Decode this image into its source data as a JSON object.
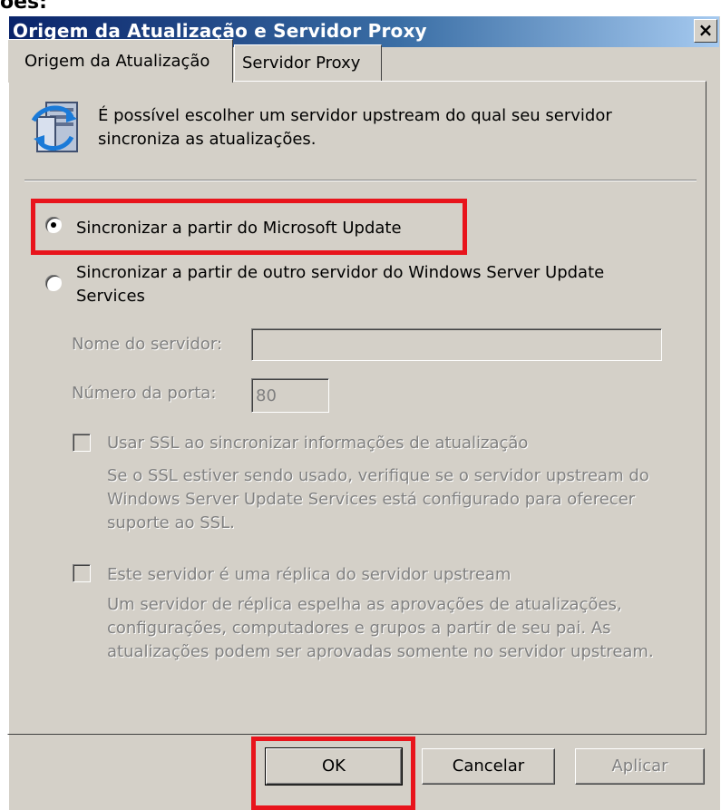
{
  "window": {
    "title": "Origem da Atualização e Servidor Proxy",
    "close_label": "×"
  },
  "tabs": [
    {
      "label": "Origem da Atualização",
      "active": true
    },
    {
      "label": "Servidor Proxy",
      "active": false
    }
  ],
  "intro_text": "É possível escolher um servidor upstream do qual seu servidor sincroniza as atualizações.",
  "options": {
    "microsoft_update": {
      "label": "Sincronizar a partir do Microsoft Update",
      "selected": true
    },
    "other_server": {
      "label": "Sincronizar a partir de outro servidor do Windows Server Update Services",
      "selected": false
    }
  },
  "fields": {
    "server_name_label": "Nome do servidor:",
    "server_name_value": "",
    "port_label": "Número da porta:",
    "port_value": "80"
  },
  "ssl": {
    "label": "Usar SSL ao sincronizar informações de atualização",
    "description": "Se o SSL estiver sendo usado, verifique se o servidor upstream do Windows Server Update Services está configurado para oferecer suporte ao SSL.",
    "checked": false
  },
  "replica": {
    "label": "Este servidor é uma réplica do servidor upstream",
    "description": "Um servidor de réplica espelha as aprovações de atualizações, configurações, computadores e grupos a partir de seu pai. As atualizações podem ser aprovadas somente no servidor upstream.",
    "checked": false
  },
  "buttons": {
    "ok": "OK",
    "cancel": "Cancelar",
    "apply": "Aplicar"
  },
  "annotation_color": "#e8141c"
}
